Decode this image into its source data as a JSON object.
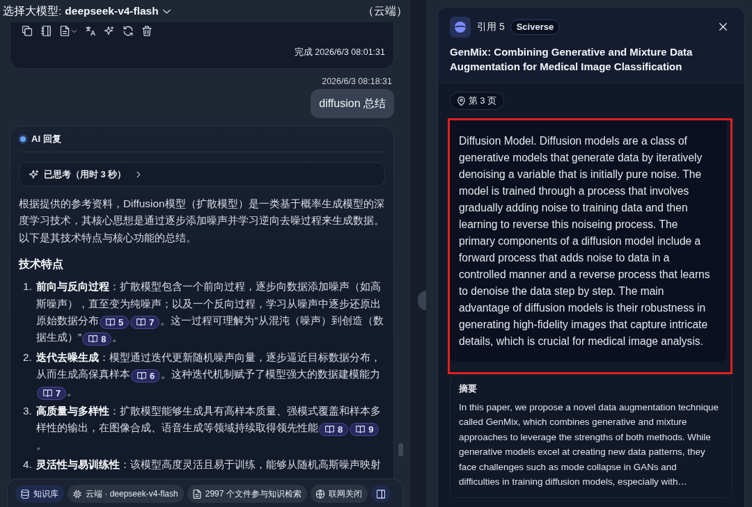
{
  "model_selector": {
    "label": "选择大模型:",
    "model": "deepseek-v4-flash",
    "deployment": "（云端）"
  },
  "previous_reply": {
    "status": "完成 2026/6/3 08:01:31"
  },
  "user_message": {
    "time": "2026/6/3 08:18:31",
    "text": "diffusion 总结"
  },
  "ai_reply": {
    "label": "AI 回复",
    "thinking": {
      "label": "已思考（用时 3 秒）",
      "expanded": false
    },
    "intro": "根据提供的参考资料，Diffusion模型（扩散模型）是一类基于概率生成模型的深度学习技术，其核心思想是通过逐步添加噪声并学习逆向去噪过程来生成数据。以下是其技术特点与核心功能的总结。",
    "section_heading": "技术特点",
    "items": [
      {
        "number": "1.",
        "parts": [
          {
            "kind": "text",
            "text": "**前向与反向过程**：扩散模型包含一个前向过程，逐步向数据添加噪声（如高斯噪声），直至变为纯噪声；以及一个反向过程，学习从噪声中逐步还原出原始数据分布"
          },
          {
            "kind": "cite",
            "label": "5"
          },
          {
            "kind": "cite",
            "label": "7"
          },
          {
            "kind": "text",
            "text": "。这一过程可理解为“从混沌（噪声）到创造（数据生成）”"
          },
          {
            "kind": "cite",
            "label": "8"
          },
          {
            "kind": "text",
            "text": "。"
          }
        ]
      },
      {
        "number": "2.",
        "parts": [
          {
            "kind": "text",
            "text": "**迭代去噪生成**：模型通过迭代更新随机噪声向量，逐步逼近目标数据分布，从而生成高保真样本"
          },
          {
            "kind": "cite",
            "label": "6"
          },
          {
            "kind": "text",
            "text": "。这种迭代机制赋予了模型强大的数据建模能力"
          },
          {
            "kind": "cite",
            "label": "7"
          },
          {
            "kind": "text",
            "text": "。"
          }
        ]
      },
      {
        "number": "3.",
        "parts": [
          {
            "kind": "text",
            "text": "**高质量与多样性**：扩散模型能够生成具有高样本质量、强模式覆盖和样本多样性的输出，在图像合成、语音生成等领域持续取得领先性能"
          },
          {
            "kind": "cite",
            "label": "8"
          },
          {
            "kind": "cite",
            "label": "9"
          },
          {
            "kind": "text",
            "text": "。"
          }
        ]
      },
      {
        "number": "4.",
        "parts": [
          {
            "kind": "text",
            "text": "**灵活性与易训练性**：该模型高度灵活且易于训练，能够从随机高斯噪声映射"
          }
        ]
      }
    ]
  },
  "bottom_bar": {
    "chips": [
      {
        "label": "知识库",
        "on": true
      },
      {
        "label": "云端 · deepseek-v4-flash",
        "on": false
      },
      {
        "label": "2997 个文件参与知识检索",
        "on": false
      },
      {
        "label": "联网关闭",
        "on": false
      },
      {
        "on": true
      }
    ]
  },
  "citation_panel": {
    "label": "引用 5",
    "source": "Sciverse",
    "title": "GenMix: Combining Generative and Mixture Data Augmentation for Medical Image Classification",
    "page": "第 3 页",
    "excerpt": {
      "text": "Diffusion Model. Diffusion models are a class of generative models that generate data by iteratively denoising a variable that is initially pure noise. The model is trained through a process that involves gradually adding noise to training data and then learning to reverse this noiseing process. The primary components of a diffusion model include a forward process that adds noise to data in a controlled manner and a reverse process that learns to denoise the data step by step. The main advantage of diffusion models is their robustness in generating high-fidelity images that capture intricate details, which is crucial for medical image analysis.",
      "highlighted": true
    },
    "abstract": {
      "heading": "摘要",
      "text": "In this paper, we propose a novel data augmentation technique called GenMix, which combines generative and mixture approaches to leverage the strengths of both methods. While generative models excel at creating new data patterns, they face challenges such as mode collapse in GANs and difficulties in training diffusion models, especially with…"
    }
  }
}
